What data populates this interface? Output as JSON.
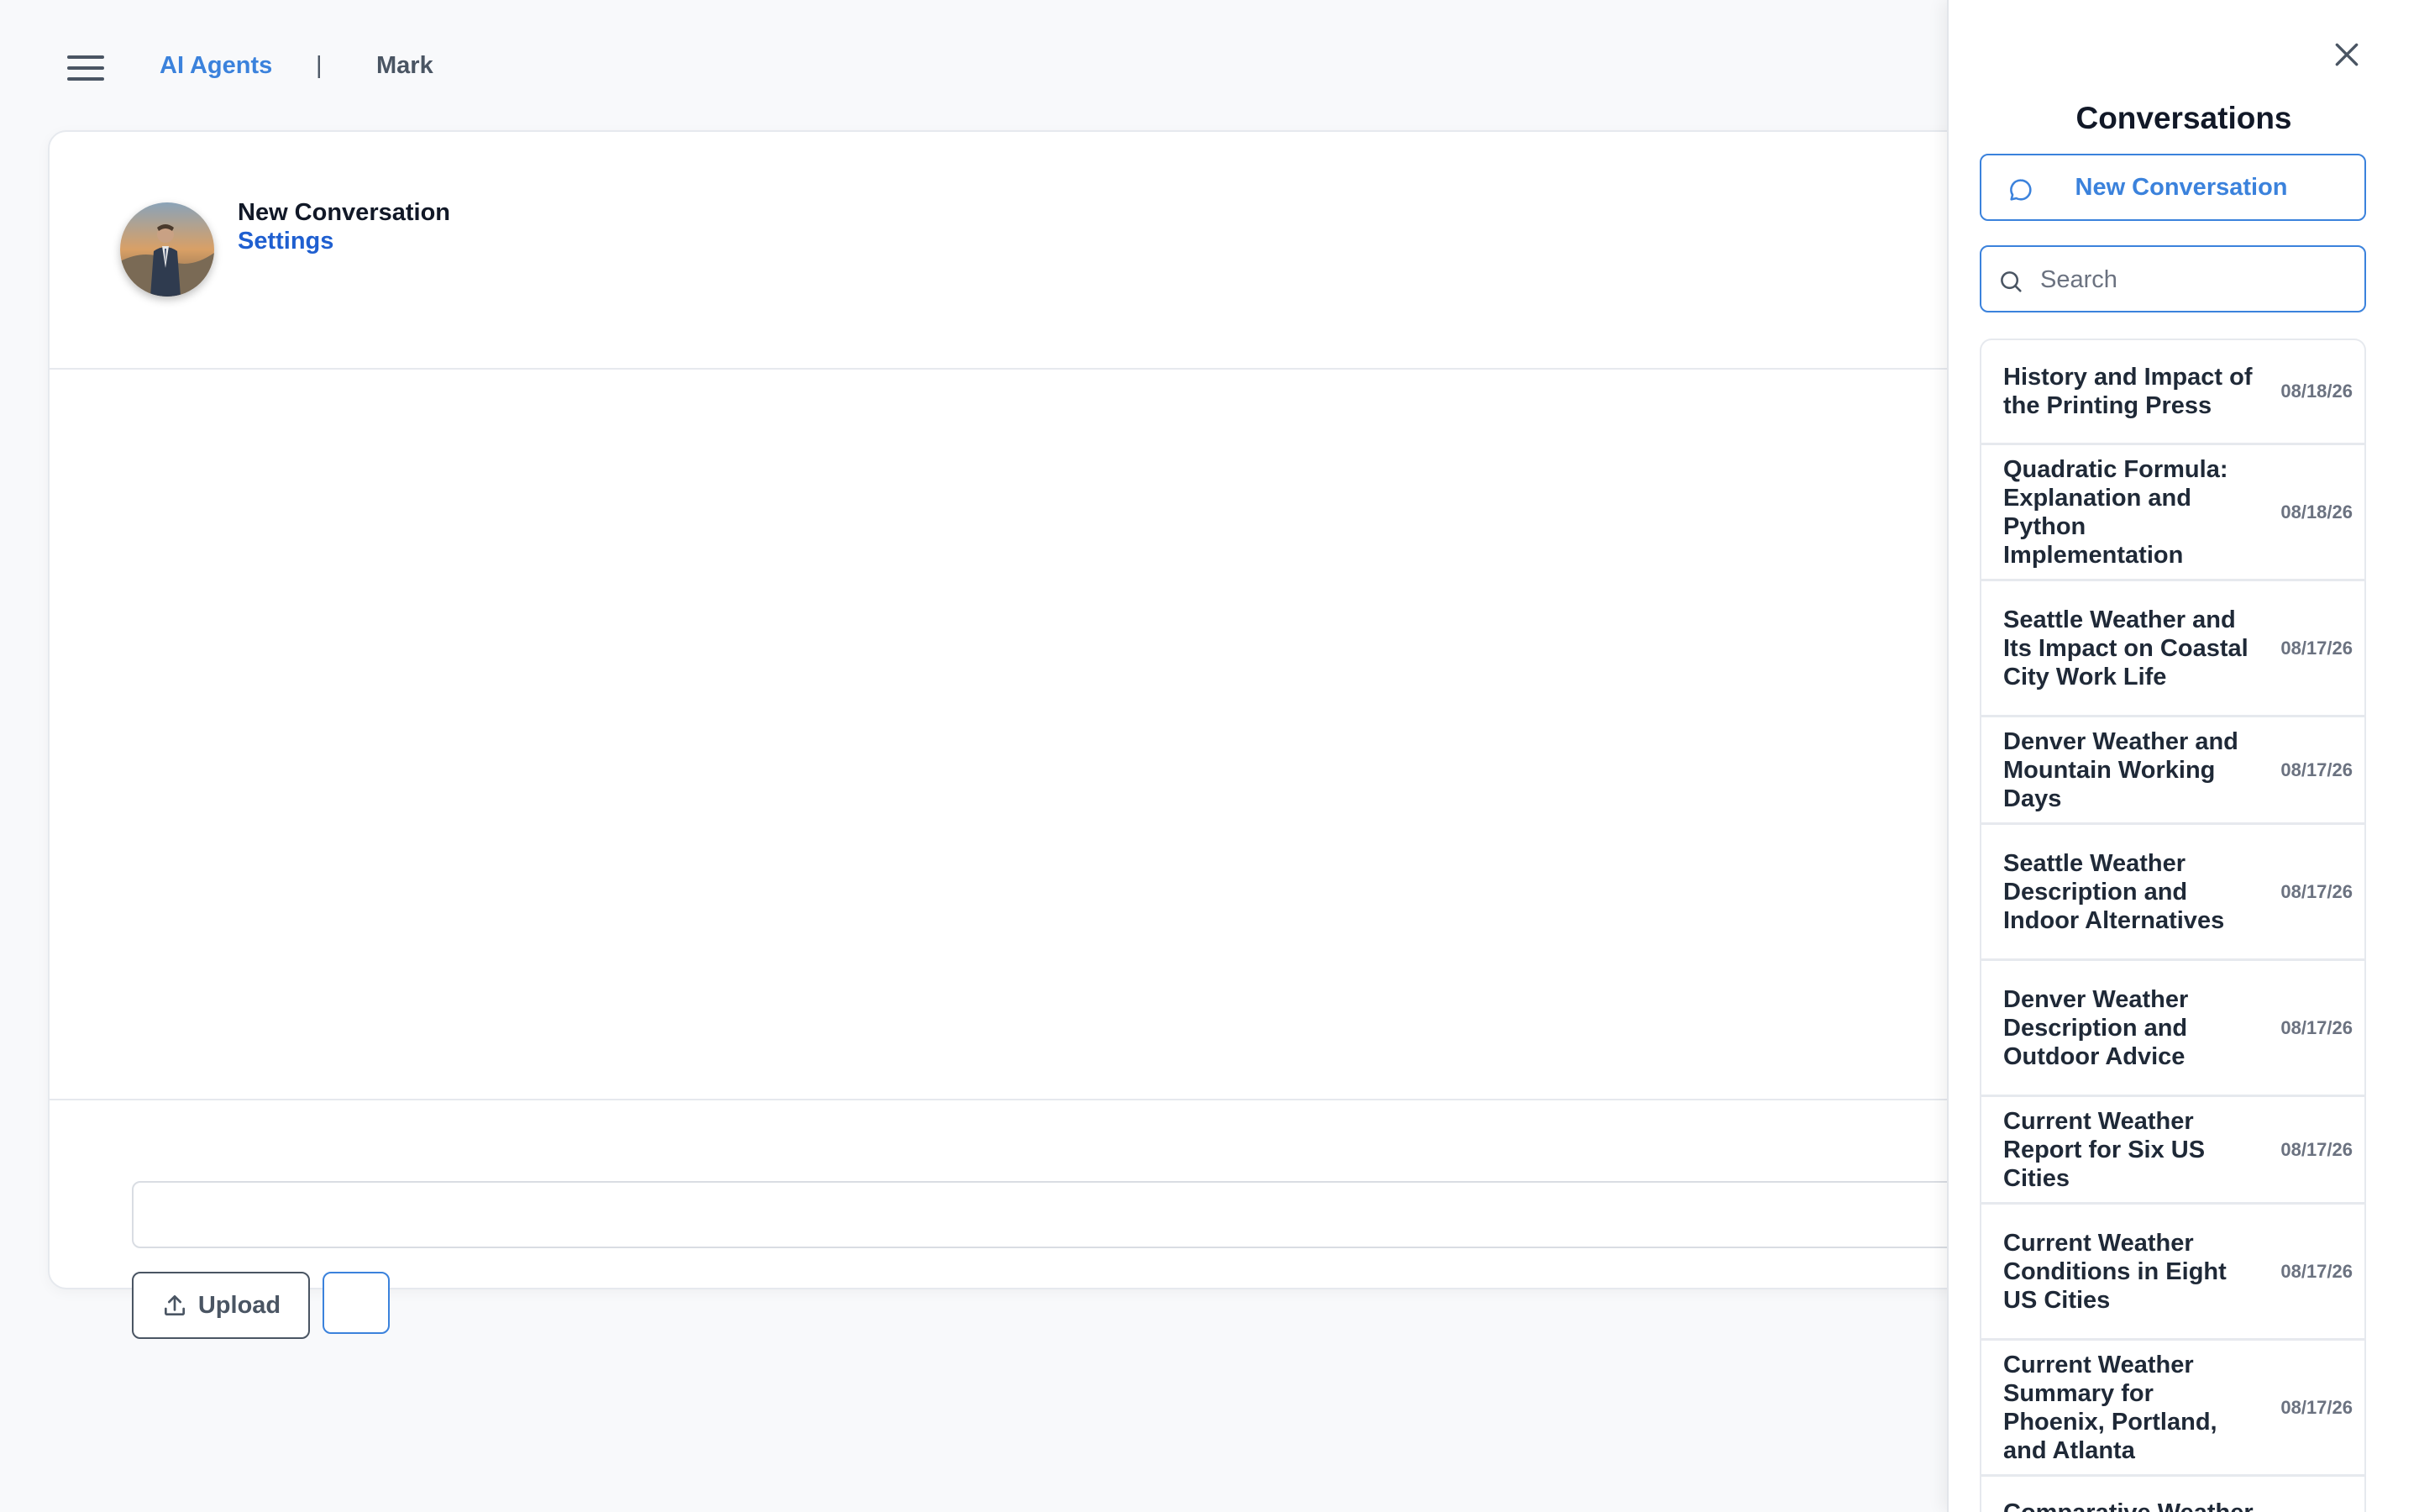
{
  "header": {
    "breadcrumb_app": "AI Agents",
    "breadcrumb_separator": "|",
    "breadcrumb_agent": "Mark"
  },
  "conversation": {
    "title": "New Conversation",
    "settings_label": "Settings",
    "input_placeholder": "",
    "upload_label": "Upload"
  },
  "panel": {
    "title": "Conversations",
    "new_conversation_label": "New Conversation",
    "search_placeholder": "Search",
    "items": [
      {
        "title": "History and Impact of the Printing Press",
        "date": "08/18/26"
      },
      {
        "title": "Quadratic Formula: Explanation and Python Implementation",
        "date": "08/18/26"
      },
      {
        "title": "Seattle Weather and Its Impact on Coastal City Work Life",
        "date": "08/17/26"
      },
      {
        "title": "Denver Weather and Mountain Working Days",
        "date": "08/17/26"
      },
      {
        "title": "Seattle Weather Description and Indoor Alternatives",
        "date": "08/17/26"
      },
      {
        "title": "Denver Weather Description and Outdoor Advice",
        "date": "08/17/26"
      },
      {
        "title": "Current Weather Report for Six US Cities",
        "date": "08/17/26"
      },
      {
        "title": "Current Weather Conditions in Eight US Cities",
        "date": "08/17/26"
      },
      {
        "title": "Current Weather Summary for Phoenix, Portland, and Atlanta",
        "date": "08/17/26"
      },
      {
        "title": "Comparative Weather",
        "date": ""
      }
    ]
  },
  "colors": {
    "accent": "#3b82dc",
    "link": "#1f5fd0",
    "text_primary": "#111827",
    "text_muted": "#6b7280",
    "border": "#e6e9ee",
    "background": "#f8f9fb"
  }
}
